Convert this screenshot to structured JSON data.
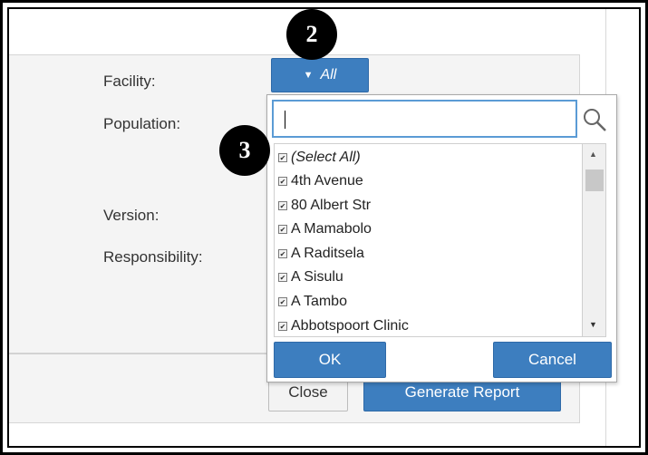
{
  "form": {
    "facility_label": "Facility:",
    "population_label": "Population:",
    "version_label": "Version:",
    "responsibility_label": "Responsibility:"
  },
  "facility_filter": {
    "value": "All",
    "icon": "filter-icon"
  },
  "dropdown": {
    "search_value": "",
    "search_icon": "magnifier-icon",
    "items": [
      {
        "label": "(Select All)",
        "checked": true
      },
      {
        "label": "4th Avenue",
        "checked": true
      },
      {
        "label": "80 Albert Str",
        "checked": true
      },
      {
        "label": "A Mamabolo",
        "checked": true
      },
      {
        "label": "A Raditsela",
        "checked": true
      },
      {
        "label": "A Sisulu",
        "checked": true
      },
      {
        "label": "A Tambo",
        "checked": true
      },
      {
        "label": "Abbotspoort Clinic",
        "checked": true
      }
    ],
    "ok_label": "OK",
    "cancel_label": "Cancel"
  },
  "footer": {
    "close_label": "Close",
    "generate_label": "Generate Report"
  },
  "annotations": {
    "step2": "2",
    "step3": "3"
  },
  "colors": {
    "accent": "#3d7ebf",
    "panel": "#f4f4f4",
    "focus": "#5b9bd5"
  }
}
